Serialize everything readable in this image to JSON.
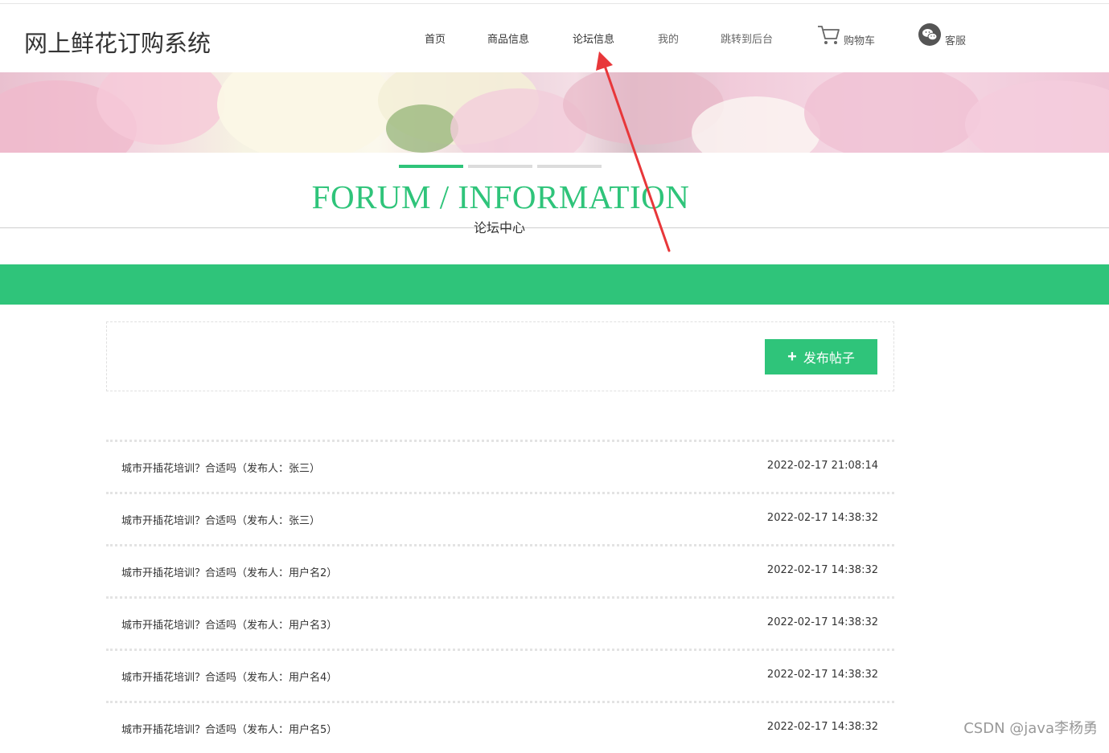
{
  "header": {
    "site_title": "网上鲜花订购系统",
    "nav": [
      "首页",
      "商品信息",
      "论坛信息",
      "我的",
      "跳转到后台"
    ],
    "cart_label": "购物车",
    "service_label": "客服"
  },
  "section": {
    "title_en": "FORUM / INFORMATION",
    "title_cn": "论坛中心"
  },
  "toolbar": {
    "post_button_label": "发布帖子"
  },
  "posts": [
    {
      "title": "城市开插花培训？合适吗（发布人：张三）",
      "time": "2022-02-17 21:08:14"
    },
    {
      "title": "城市开插花培训？合适吗（发布人：张三）",
      "time": "2022-02-17 14:38:32"
    },
    {
      "title": "城市开插花培训？合适吗（发布人：用户名2）",
      "time": "2022-02-17 14:38:32"
    },
    {
      "title": "城市开插花培训？合适吗（发布人：用户名3）",
      "time": "2022-02-17 14:38:32"
    },
    {
      "title": "城市开插花培训？合适吗（发布人：用户名4）",
      "time": "2022-02-17 14:38:32"
    },
    {
      "title": "城市开插花培训？合适吗（发布人：用户名5）",
      "time": "2022-02-17 14:38:32"
    }
  ],
  "watermark": "CSDN @java李杨勇",
  "colors": {
    "accent": "#2fc47a",
    "annotation_arrow": "#e8373a"
  },
  "icons": [
    "cart-icon",
    "wechat-icon",
    "plus-icon",
    "annotation-arrow"
  ]
}
